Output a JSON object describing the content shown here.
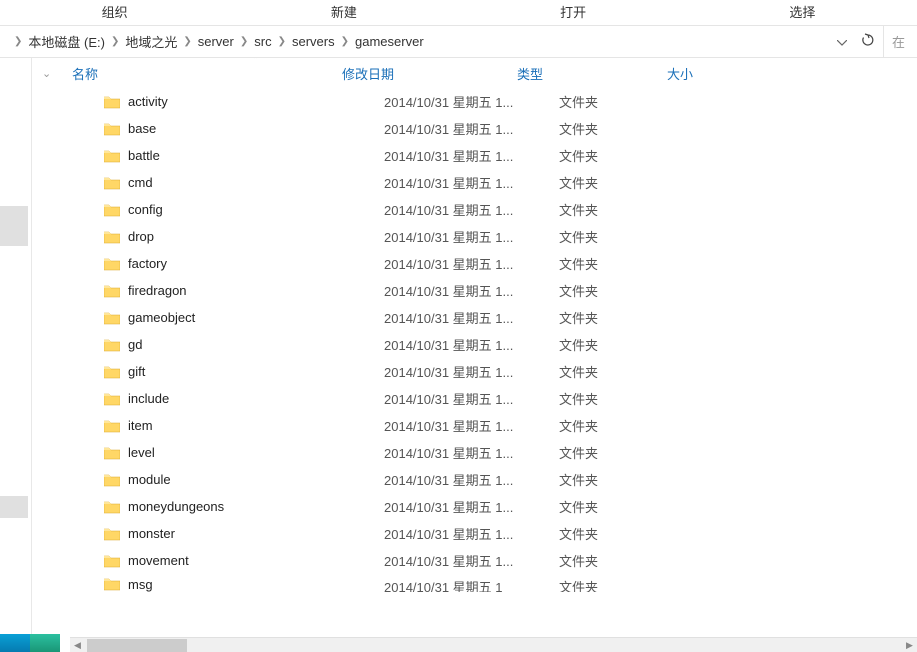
{
  "toolbar": {
    "organize": "组织",
    "new": "新建",
    "open": "打开",
    "select": "选择"
  },
  "breadcrumb": {
    "items": [
      "本地磁盘 (E:)",
      "地域之光",
      "server",
      "src",
      "servers",
      "gameserver"
    ]
  },
  "search_placeholder": "在",
  "columns": {
    "name": "名称",
    "date": "修改日期",
    "type": "类型",
    "size": "大小"
  },
  "folder_type": "文件夹",
  "date_prefix": "2014/10/31 星期五 1...",
  "files": [
    {
      "name": "activity"
    },
    {
      "name": "base"
    },
    {
      "name": "battle"
    },
    {
      "name": "cmd"
    },
    {
      "name": "config"
    },
    {
      "name": "drop"
    },
    {
      "name": "factory"
    },
    {
      "name": "firedragon"
    },
    {
      "name": "gameobject"
    },
    {
      "name": "gd"
    },
    {
      "name": "gift"
    },
    {
      "name": "include"
    },
    {
      "name": "item"
    },
    {
      "name": "level"
    },
    {
      "name": "module"
    },
    {
      "name": "moneydungeons"
    },
    {
      "name": "monster"
    },
    {
      "name": "movement"
    },
    {
      "name": "msg"
    }
  ]
}
